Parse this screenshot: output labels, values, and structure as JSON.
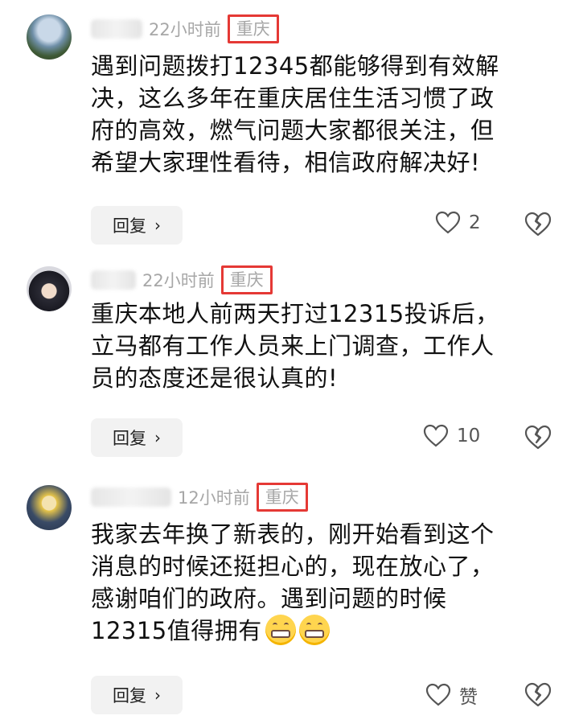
{
  "comments": [
    {
      "time": "22小时前",
      "region": "重庆",
      "text": "遇到问题拨打12345都能够得到有效解\n决，这么多年在重庆居住生活习惯了政\n府的高效，燃气问题大家都很关注，但\n希望大家理性看待，相信政府解决好!",
      "reply_label": "回复",
      "like_count": "2"
    },
    {
      "time": "22小时前",
      "region": "重庆",
      "text": "重庆本地人前两天打过12315投诉后，\n立马都有工作人员来上门调查，工作人\n员的态度还是很认真的!",
      "reply_label": "回复",
      "like_count": "10"
    },
    {
      "time": "12小时前",
      "region": "重庆",
      "text_main": "我家去年换了新表的，刚开始看到这个\n消息的时候还挺担心的，现在放心了，\n感谢咱们的政府。遇到问题的时候\n12315值得拥有",
      "emojis": [
        "grinning-emoji",
        "grinning-emoji"
      ],
      "reply_label": "回复",
      "like_count": "赞"
    }
  ],
  "icons": {
    "reply_chevron": "chevron-right-icon",
    "like": "heart-outline-icon",
    "dislike": "broken-heart-icon"
  },
  "colors": {
    "region_highlight_border": "#e53935",
    "meta_gray": "#a7a7a7",
    "reply_bg": "#f2f2f2"
  }
}
